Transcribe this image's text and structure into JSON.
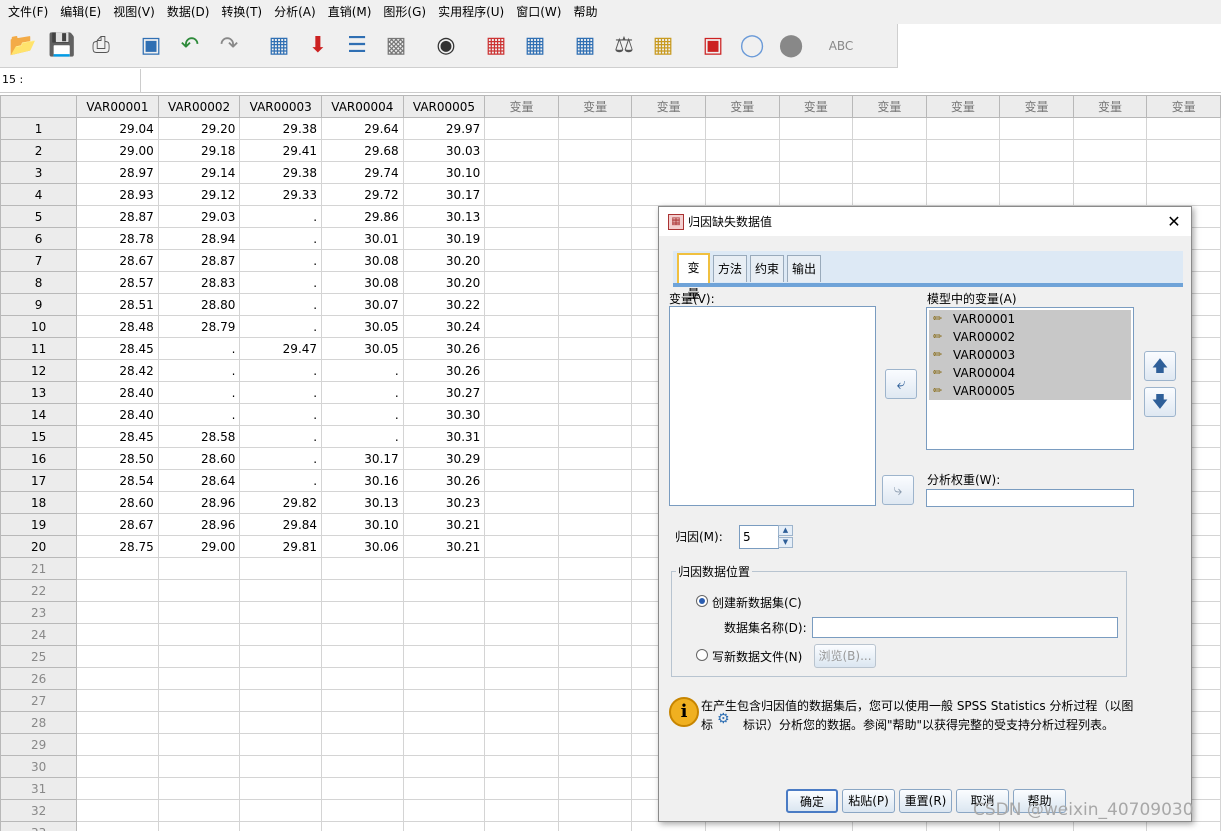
{
  "menu": [
    "文件(F)",
    "编辑(E)",
    "视图(V)",
    "数据(D)",
    "转换(T)",
    "分析(A)",
    "直销(M)",
    "图形(G)",
    "实用程序(U)",
    "窗口(W)",
    "帮助"
  ],
  "toolbar_icons": [
    "open-folder-icon",
    "save-icon",
    "print-icon",
    "recall-dialog-icon",
    "undo-icon",
    "redo-icon",
    "goto-case-icon",
    "goto-variable-icon",
    "variables-icon",
    "run-descriptives-icon",
    "find-icon",
    "insert-cases-icon",
    "insert-variable-icon",
    "split-file-icon",
    "weight-cases-icon",
    "select-cases-icon",
    "value-labels-icon",
    "use-sets-icon",
    "show-all-variables-icon",
    "spell-check-icon"
  ],
  "cell_ref": {
    "label": "15 :",
    "value": ""
  },
  "grid": {
    "columns": [
      "VAR00001",
      "VAR00002",
      "VAR00003",
      "VAR00004",
      "VAR00005"
    ],
    "empty_column_label": "变量",
    "rows": [
      [
        "1",
        "29.04",
        "29.20",
        "29.38",
        "29.64",
        "29.97"
      ],
      [
        "2",
        "29.00",
        "29.18",
        "29.41",
        "29.68",
        "30.03"
      ],
      [
        "3",
        "28.97",
        "29.14",
        "29.38",
        "29.74",
        "30.10"
      ],
      [
        "4",
        "28.93",
        "29.12",
        "29.33",
        "29.72",
        "30.17"
      ],
      [
        "5",
        "28.87",
        "29.03",
        ".",
        "29.86",
        "30.13"
      ],
      [
        "6",
        "28.78",
        "28.94",
        ".",
        "30.01",
        "30.19"
      ],
      [
        "7",
        "28.67",
        "28.87",
        ".",
        "30.08",
        "30.20"
      ],
      [
        "8",
        "28.57",
        "28.83",
        ".",
        "30.08",
        "30.20"
      ],
      [
        "9",
        "28.51",
        "28.80",
        ".",
        "30.07",
        "30.22"
      ],
      [
        "10",
        "28.48",
        "28.79",
        ".",
        "30.05",
        "30.24"
      ],
      [
        "11",
        "28.45",
        ".",
        "29.47",
        "30.05",
        "30.26"
      ],
      [
        "12",
        "28.42",
        ".",
        ".",
        ".",
        "30.26"
      ],
      [
        "13",
        "28.40",
        ".",
        ".",
        ".",
        "30.27"
      ],
      [
        "14",
        "28.40",
        ".",
        ".",
        ".",
        "30.30"
      ],
      [
        "15",
        "28.45",
        "28.58",
        ".",
        ".",
        "30.31"
      ],
      [
        "16",
        "28.50",
        "28.60",
        ".",
        "30.17",
        "30.29"
      ],
      [
        "17",
        "28.54",
        "28.64",
        ".",
        "30.16",
        "30.26"
      ],
      [
        "18",
        "28.60",
        "28.96",
        "29.82",
        "30.13",
        "30.23"
      ],
      [
        "19",
        "28.67",
        "28.96",
        "29.84",
        "30.10",
        "30.21"
      ],
      [
        "20",
        "28.75",
        "29.00",
        "29.81",
        "30.06",
        "30.21"
      ]
    ],
    "empty_rows": [
      "21",
      "22",
      "23",
      "24",
      "25",
      "26",
      "27",
      "28",
      "29",
      "30",
      "31",
      "32",
      "33"
    ]
  },
  "dialog": {
    "title": "归因缺失数据值",
    "tabs": [
      "变量",
      "方法",
      "约束",
      "输出"
    ],
    "variables_label": "变量(V):",
    "model_vars_label": "模型中的变量(A)",
    "model_vars": [
      "VAR00001",
      "VAR00002",
      "VAR00003",
      "VAR00004",
      "VAR00005"
    ],
    "weight_label": "分析权重(W):",
    "imputations_label": "归因(M):",
    "imputations_value": "5",
    "location_group": "归因数据位置",
    "create_new_label": "创建新数据集(C)",
    "dataset_name_label": "数据集名称(D):",
    "write_new_label": "写新数据文件(N)",
    "browse_label": "浏览(B)...",
    "info_text_1": "在产生包含归因值的数据集后，您可以使用一般 SPSS Statistics 分析过程（以图",
    "info_text_2a": "标",
    "info_text_2b": "标识）分析您的数据。参阅\"帮助\"以获得完整的受支持分析过程列表。",
    "buttons": [
      "确定",
      "粘贴(P)",
      "重置(R)",
      "取消",
      "帮助"
    ]
  },
  "watermark": "CSDN @weixin_40709030"
}
